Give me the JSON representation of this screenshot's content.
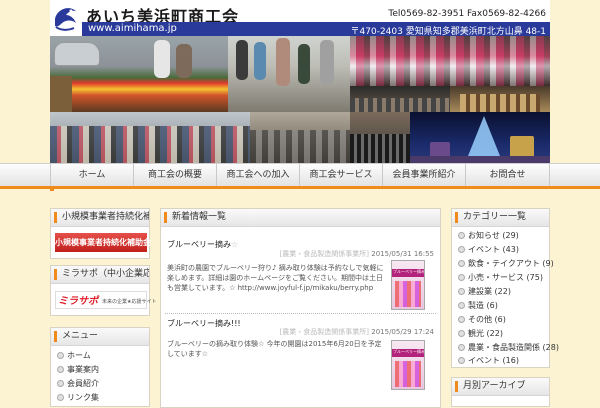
{
  "header": {
    "site_title": "あいち美浜町商工会",
    "url": "www.aimihama.jp",
    "phone": "Tel0569-82-3951 Fax0569-82-4266",
    "address": "〒470-2403 愛知県知多郡美浜町北方山鼻 48-1"
  },
  "nav": {
    "items": [
      "ホーム",
      "商工会の概要",
      "商工会への加入",
      "商工会サービス",
      "会員事業所紹介",
      "お問合せ"
    ]
  },
  "left_sidebar": {
    "subsidy_title": "小規模事業者持続化補助金のご案内",
    "subsidy_button": "小規模事業者持続化補助金",
    "mirasapo_title": "ミラサポ（中小企業応援サイト）",
    "mirasapo_logo": "ミラサポ",
    "mirasapo_sub": "未来の企業★応援サイト",
    "menu_title": "メニュー",
    "menu_items": [
      "ホーム",
      "事業案内",
      "会員紹介",
      "リンク集"
    ]
  },
  "news": {
    "title": "新着情報一覧",
    "posts": [
      {
        "title": "ブルーベリー摘み",
        "title_suffix": "☆",
        "category": "[農業・食品製造関係事業所]",
        "date": "2015/05/31 16:55",
        "body": "美浜町の農園でブルーベリー狩り♪ 摘み取り体験は予約なしで気軽に楽しめます。詳細は園のホームページをご覧ください。期間中は土日も営業しています。☆ http://www.joyful-f.jp/mikaku/berry.php"
      },
      {
        "title": "ブルーベリー摘み!!!",
        "title_suffix": "",
        "category": "[農業・食品製造関係事業所]",
        "date": "2015/05/29 17:24",
        "body": "ブルーベリーの摘み取り体験☆ 今年の開園は2015年6月20日を予定しています☆"
      }
    ],
    "flyer_label": "ブルーベリー摘み"
  },
  "right_sidebar": {
    "categories_title": "カテゴリー一覧",
    "categories": [
      "お知らせ (29)",
      "イベント (43)",
      "飲食・テイクアウト (9)",
      "小売・サービス (75)",
      "建設業 (22)",
      "製造 (6)",
      "その他 (6)",
      "観光 (22)",
      "農業・食品製造関係 (28)",
      "イベント (16)"
    ],
    "archive_title": "月別アーカイブ"
  },
  "colors": {
    "accent": "#f08a1c",
    "url_bar": "#2a3a9a",
    "background": "#fbf3d2",
    "button_red": "#c0201c"
  }
}
